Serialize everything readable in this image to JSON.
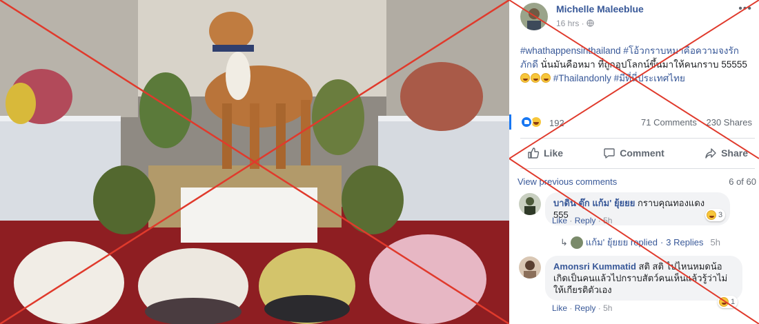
{
  "post": {
    "author": "Michelle Maleeblue",
    "time": "16 hrs ·",
    "privacy_icon": "globe-icon",
    "more_icon": "more-horizontal-icon",
    "text_tag1": "#whathappensinthailand",
    "text_tag2": "#โอ้วกราบหมาคือความจงรักภักดี",
    "text_plain": "นั่นมันคือหมา ที่ถูกอุปโลกน์ขึ้นมาให้คนกราบ 55555",
    "text_tag3": "#Thailandonly",
    "text_tag4": "#มีที่นี่ประเทศไทย",
    "reaction_count": "192",
    "comments_count": "71 Comments",
    "shares_count": "230 Shares",
    "like_label": "Like",
    "comment_label": "Comment",
    "share_label": "Share"
  },
  "comments_section": {
    "view_previous": "View previous comments",
    "count": "6 of 60",
    "comments": [
      {
        "author": "บาดิน ตุ๊ก แก้ม' ยุ้ยยย",
        "text": "กราบคุณทองแดง 555",
        "like": "Like",
        "reply": "Reply",
        "age": "5h",
        "reactions": "3"
      },
      {
        "author": "Amonsri Kummatid",
        "text": "สติ สติ ไปไหนหมดน้อ เกิดเป็นคนแล้วไปกราบสัตว์คนเห็นแล้วรู้ว่าไม่ให้เกียรติตัวเอง",
        "like": "Like",
        "reply": "Reply",
        "age": "5h",
        "reactions": "1"
      }
    ],
    "reply_summary": {
      "replier": "แก้ม' ยุ้ยยย replied",
      "replies": "3 Replies",
      "age": "5h"
    }
  },
  "colors": {
    "link_blue": "#385898",
    "fb_blue": "#1877f2",
    "cross_red": "#e03a2c"
  }
}
